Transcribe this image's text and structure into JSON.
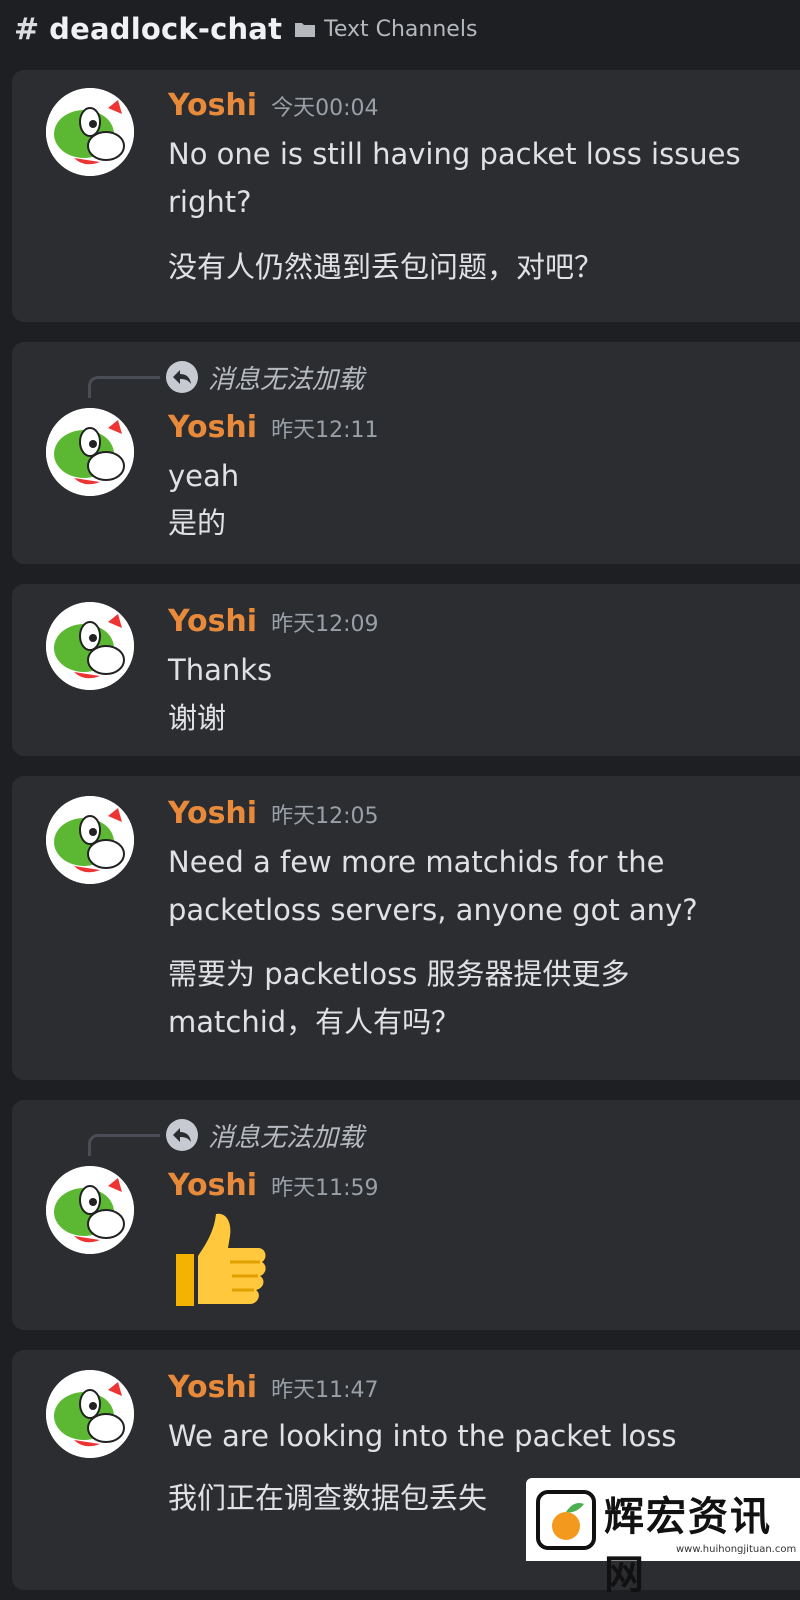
{
  "header": {
    "hash_icon": "#",
    "channel_name": "deadlock-chat",
    "category_icon": "folder-icon",
    "category": "Text Channels"
  },
  "messages": [
    {
      "username": "Yoshi",
      "timestamp": "今天00:04",
      "lines": [
        "No one is still having packet loss issues right?",
        "没有人仍然遇到丢包问题，对吧？"
      ]
    },
    {
      "reply_text": "消息无法加载",
      "username": "Yoshi",
      "timestamp": "昨天12:11",
      "lines": [
        "yeah",
        "是的"
      ]
    },
    {
      "username": "Yoshi",
      "timestamp": "昨天12:09",
      "lines": [
        "Thanks",
        "谢谢"
      ]
    },
    {
      "username": "Yoshi",
      "timestamp": "昨天12:05",
      "lines": [
        "Need a few more matchids for the packetloss servers, anyone got any?",
        "需要为 packetloss 服务器提供更多 matchid，有人有吗？"
      ]
    },
    {
      "reply_text": "消息无法加载",
      "username": "Yoshi",
      "timestamp": "昨天11:59",
      "emoji": "thumbs-up-icon"
    },
    {
      "username": "Yoshi",
      "timestamp": "昨天11:47",
      "lines": [
        "We are looking into the packet loss",
        "我们正在调查数据包丢失"
      ]
    }
  ],
  "watermark": {
    "text": "辉宏资讯网",
    "url": "www.huihongjituan.com"
  },
  "colors": {
    "background": "#1e1f23",
    "card": "#2b2d31",
    "username": "#e98a3b",
    "timestamp": "#9aa0a8"
  }
}
